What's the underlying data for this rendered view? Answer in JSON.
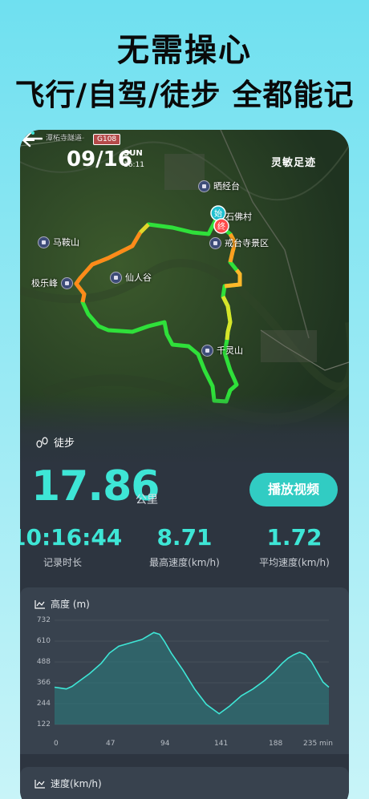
{
  "promo": {
    "line1": "无需操心",
    "line2": "飞行/自驾/徒步 全都能记"
  },
  "header": {
    "date": "09/16",
    "day": "SUN",
    "time": "16:11",
    "brand": "灵敏足迹",
    "road_badge": "G108"
  },
  "map": {
    "tunnel_label": "潭柘寺隧道",
    "pois": [
      {
        "name": "晒经台"
      },
      {
        "name": "石佛村"
      },
      {
        "name": "戒台寺景区"
      },
      {
        "name": "马鞍山"
      },
      {
        "name": "仙人谷"
      },
      {
        "name": "极乐峰"
      },
      {
        "name": "千灵山"
      }
    ],
    "start_marker": "始",
    "end_marker": "终"
  },
  "summary": {
    "mode": "徒步",
    "distance": "17.86",
    "distance_unit": "公里",
    "play_button": "播放视频",
    "stats": [
      {
        "value": "10:16:44",
        "label": "记录时长"
      },
      {
        "value": "8.71",
        "label": "最高速度(km/h)"
      },
      {
        "value": "1.72",
        "label": "平均速度(km/h)"
      }
    ]
  },
  "altitude_chart": {
    "title": "高度 (m)",
    "y_ticks": [
      "732",
      "610",
      "488",
      "366",
      "244",
      "122"
    ],
    "x_ticks": [
      "0",
      "47",
      "94",
      "141",
      "188",
      "235 min"
    ]
  },
  "speed_chart": {
    "title": "速度(km/h)"
  },
  "chart_data": {
    "type": "area",
    "title": "高度 (m)",
    "xlabel": "",
    "ylabel": "",
    "x_unit": "min",
    "xlim": [
      0,
      235
    ],
    "ylim": [
      122,
      732
    ],
    "x": [
      0,
      5,
      10,
      15,
      20,
      30,
      40,
      47,
      55,
      65,
      75,
      85,
      90,
      94,
      100,
      110,
      120,
      130,
      141,
      150,
      160,
      170,
      180,
      188,
      195,
      200,
      205,
      210,
      215,
      220,
      225,
      230,
      235
    ],
    "values": [
      340,
      335,
      330,
      345,
      370,
      420,
      480,
      540,
      580,
      600,
      620,
      660,
      650,
      610,
      540,
      440,
      330,
      240,
      185,
      230,
      290,
      330,
      380,
      430,
      480,
      510,
      530,
      545,
      530,
      490,
      430,
      370,
      340
    ],
    "colors": {
      "line": "#3ee6d6",
      "fill": "#2a7f80"
    }
  }
}
